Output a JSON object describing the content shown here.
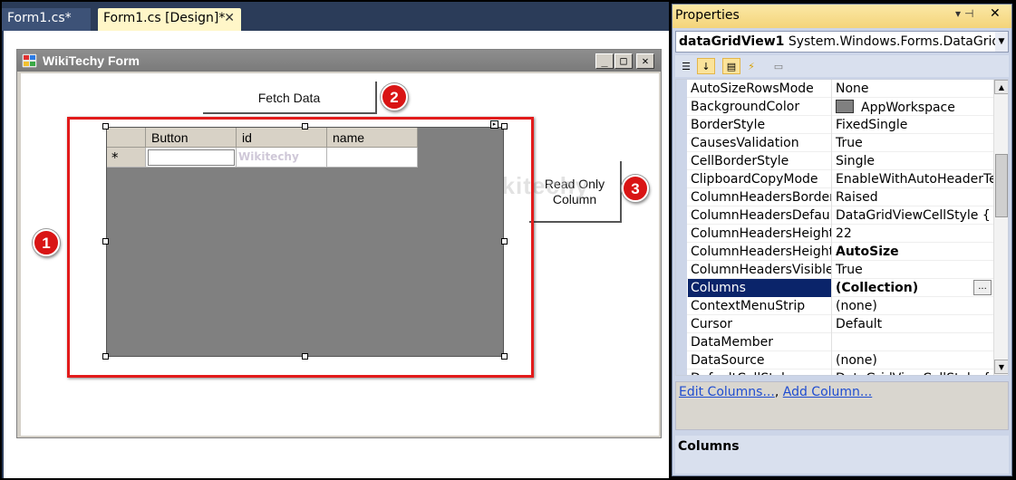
{
  "tabs": [
    {
      "label": "Form1.cs*"
    },
    {
      "label": "Form1.cs [Design]*"
    }
  ],
  "form": {
    "title": "WikiTechy Form",
    "fetch_button_label": "Fetch Data",
    "readonly_button_label_line1": "Read Only",
    "readonly_button_label_line2": "Column"
  },
  "grid": {
    "columns": [
      "Button",
      "id",
      "name"
    ],
    "new_row_marker": "*",
    "watermark_cell": "Wikitechy"
  },
  "watermark": "Wikitechy",
  "badges": [
    "1",
    "2",
    "3"
  ],
  "properties": {
    "title": "Properties",
    "object_name": "dataGridView1",
    "object_type": "System.Windows.Forms.DataGridView",
    "rows": [
      {
        "name": "AutoSizeRowsMode",
        "value": "None"
      },
      {
        "name": "BackgroundColor",
        "value": "AppWorkspace"
      },
      {
        "name": "BorderStyle",
        "value": "FixedSingle"
      },
      {
        "name": "CausesValidation",
        "value": "True"
      },
      {
        "name": "CellBorderStyle",
        "value": "Single"
      },
      {
        "name": "ClipboardCopyMode",
        "value": "EnableWithAutoHeaderText"
      },
      {
        "name": "ColumnHeadersBorderSt",
        "value": "Raised"
      },
      {
        "name": "ColumnHeadersDefaultC",
        "value": "DataGridViewCellStyle { Back"
      },
      {
        "name": "ColumnHeadersHeight",
        "value": "22"
      },
      {
        "name": "ColumnHeadersHeightSi",
        "value": "AutoSize"
      },
      {
        "name": "ColumnHeadersVisible",
        "value": "True"
      },
      {
        "name": "Columns",
        "value": "(Collection)"
      },
      {
        "name": "ContextMenuStrip",
        "value": "(none)"
      },
      {
        "name": "Cursor",
        "value": "Default"
      },
      {
        "name": "DataMember",
        "value": ""
      },
      {
        "name": "DataSource",
        "value": "(none)"
      },
      {
        "name": "DefaultCellStyle",
        "value": "DataGridViewCellStyle { Back"
      }
    ],
    "ellipsis_label": "...",
    "commands": {
      "edit_columns": "Edit Columns...",
      "separator": ", ",
      "add_column": "Add Column..."
    },
    "description_title": "Columns"
  },
  "colors": {
    "accent_red": "#e21b1b",
    "selected_row": "#0a246a",
    "grid_background": "#808080",
    "link": "#1f4dd1"
  }
}
